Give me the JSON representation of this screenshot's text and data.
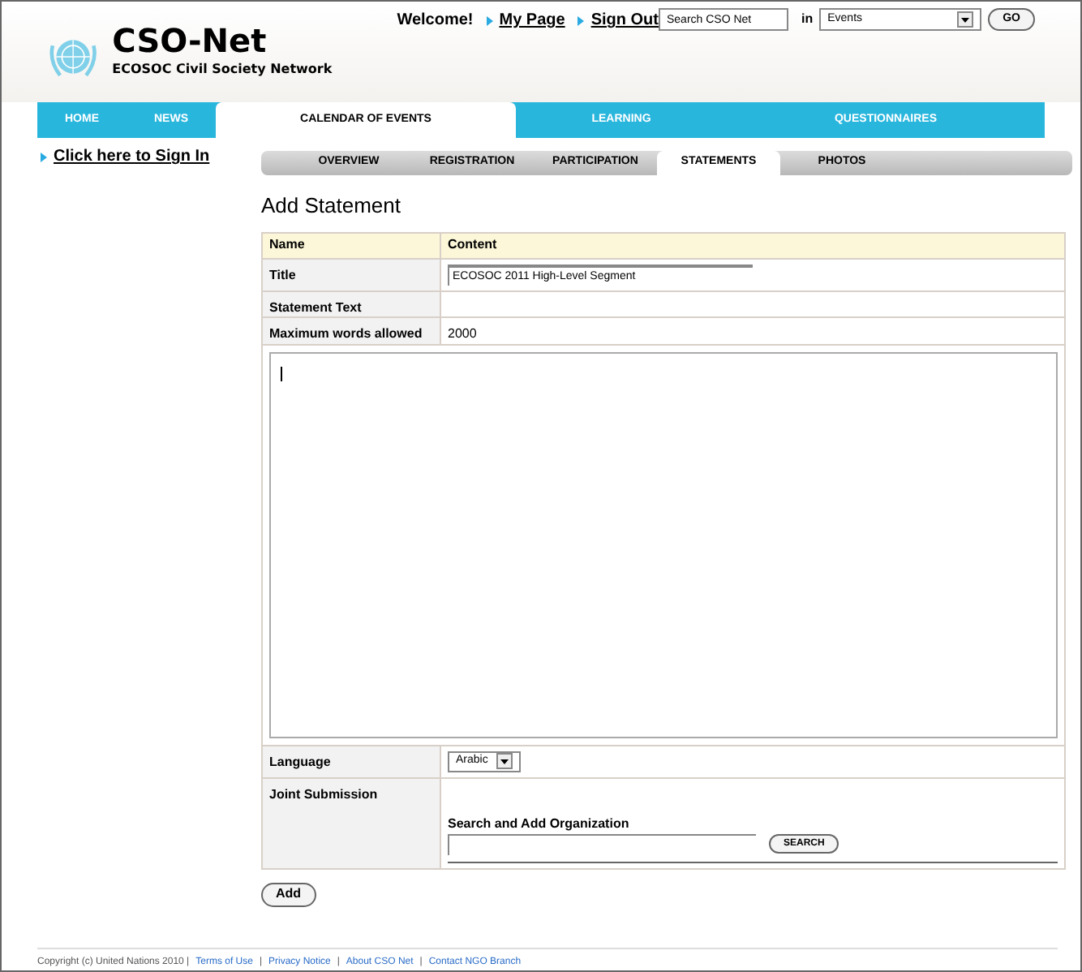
{
  "header": {
    "site_title": "CSO-Net",
    "subtitle": "ECOSOC Civil Society Network",
    "welcome": "Welcome!",
    "links": [
      "My Page",
      "Sign Out"
    ],
    "search": {
      "value": "Search CSO Net",
      "in_label": "in",
      "scope": "Events",
      "go": "GO"
    }
  },
  "nav": [
    {
      "label": "HOME",
      "selected": false
    },
    {
      "label": "NEWS",
      "selected": false
    },
    {
      "label": "CALENDAR OF EVENTS",
      "selected": true
    },
    {
      "label": "LEARNING",
      "selected": false
    },
    {
      "label": "QUESTIONNAIRES",
      "selected": false
    }
  ],
  "sidebar": {
    "sign_in": "Click here to Sign In"
  },
  "subtabs": [
    {
      "label": "OVERVIEW",
      "selected": false
    },
    {
      "label": "REGISTRATION",
      "selected": false
    },
    {
      "label": "PARTICIPATION",
      "selected": false
    },
    {
      "label": "STATEMENTS",
      "selected": true
    },
    {
      "label": "PHOTOS",
      "selected": false
    }
  ],
  "heading": "Add Statement",
  "form": {
    "columns": [
      "Name",
      "Content"
    ],
    "title_label": "Title",
    "title_value": "ECOSOC 2011 High-Level Segment",
    "text_label": "Statement Text",
    "max_label": "Maximum words allowed",
    "max_value": "2000",
    "language_label": "Language",
    "language_value": "Arabic",
    "joint_label": "Joint Submission",
    "org_label": "Search and Add Organization",
    "search_button": "SEARCH"
  },
  "add_button": "Add",
  "footer": {
    "copyright": "Copyright (c) United Nations 2010 |",
    "links": [
      "Terms of Use",
      "Privacy Notice",
      "About CSO Net",
      "Contact NGO Branch"
    ],
    "separator": "|"
  }
}
